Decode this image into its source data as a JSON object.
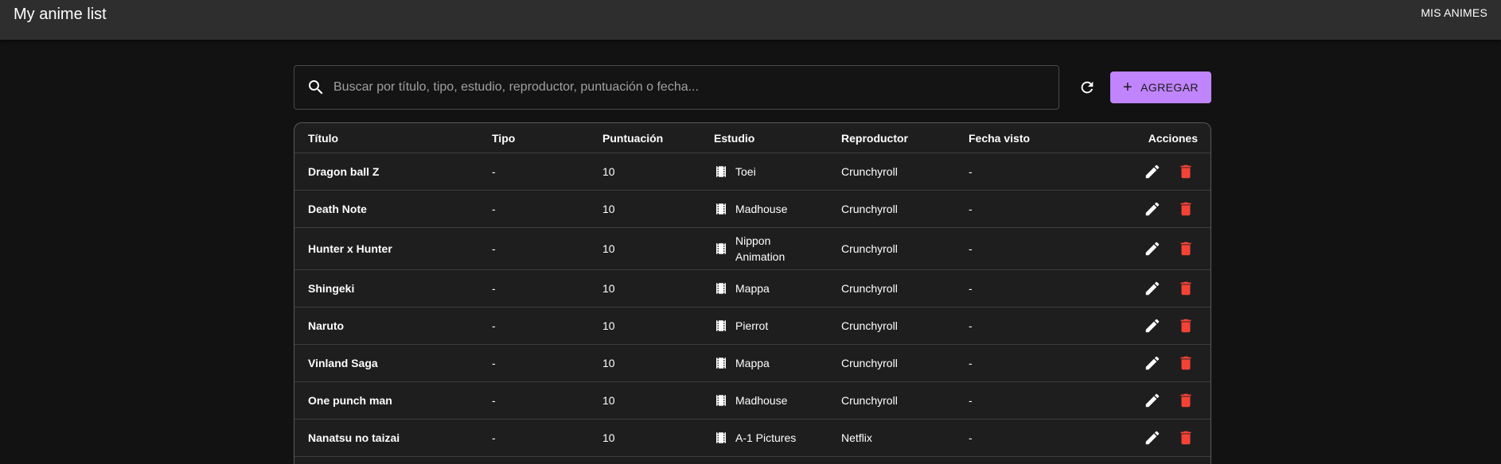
{
  "app": {
    "title": "My anime list",
    "nav_label": "MIS ANIMES"
  },
  "search": {
    "placeholder": "Buscar por título, tipo, estudio, reproductor, puntuación o fecha...",
    "value": ""
  },
  "toolbar": {
    "add_label": "AGREGAR"
  },
  "colors": {
    "accent": "#c084fc",
    "danger": "#f44336",
    "appbar": "#2e2e2e",
    "background": "#121212"
  },
  "table": {
    "headers": [
      "Título",
      "Tipo",
      "Puntuación",
      "Estudio",
      "Reproductor",
      "Fecha visto",
      "Acciones"
    ],
    "rows": [
      {
        "titulo": "Dragon ball Z",
        "tipo": "-",
        "puntuacion": "10",
        "estudio": "Toei",
        "reproductor": "Crunchyroll",
        "fecha": "-"
      },
      {
        "titulo": "Death Note",
        "tipo": "-",
        "puntuacion": "10",
        "estudio": "Madhouse",
        "reproductor": "Crunchyroll",
        "fecha": "-"
      },
      {
        "titulo": "Hunter x Hunter",
        "tipo": "-",
        "puntuacion": "10",
        "estudio": "Nippon Animation",
        "reproductor": "Crunchyroll",
        "fecha": "-"
      },
      {
        "titulo": "Shingeki",
        "tipo": "-",
        "puntuacion": "10",
        "estudio": "Mappa",
        "reproductor": "Crunchyroll",
        "fecha": "-"
      },
      {
        "titulo": "Naruto",
        "tipo": "-",
        "puntuacion": "10",
        "estudio": "Pierrot",
        "reproductor": "Crunchyroll",
        "fecha": "-"
      },
      {
        "titulo": "Vinland Saga",
        "tipo": "-",
        "puntuacion": "10",
        "estudio": "Mappa",
        "reproductor": "Crunchyroll",
        "fecha": "-"
      },
      {
        "titulo": "One punch man",
        "tipo": "-",
        "puntuacion": "10",
        "estudio": "Madhouse",
        "reproductor": "Crunchyroll",
        "fecha": "-"
      },
      {
        "titulo": "Nanatsu no taizai",
        "tipo": "-",
        "puntuacion": "10",
        "estudio": "A-1 Pictures",
        "reproductor": "Netflix",
        "fecha": "-"
      }
    ]
  }
}
